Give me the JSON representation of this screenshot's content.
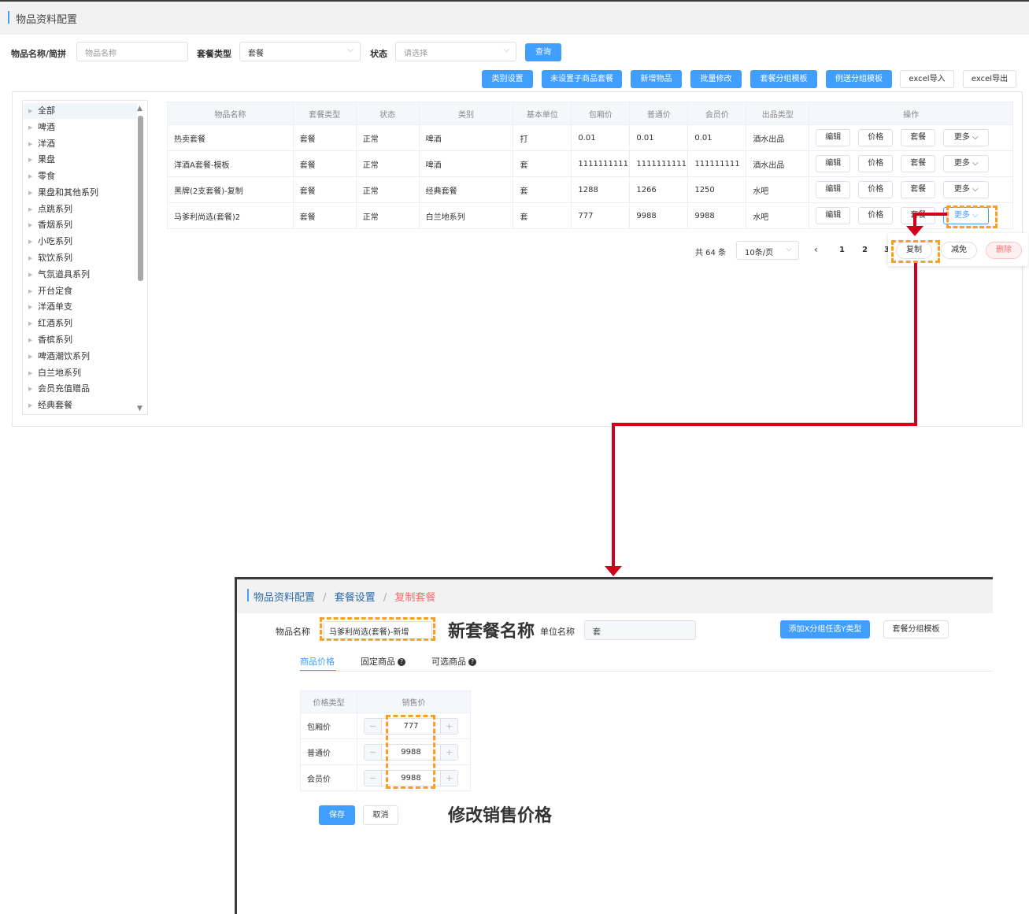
{
  "top": {
    "title": "物品资料配置",
    "filters": {
      "name_label": "物品名称/简拼",
      "name_placeholder": "物品名称",
      "type_label": "套餐类型",
      "type_value": "套餐",
      "status_label": "状态",
      "status_placeholder": "请选择",
      "query_button": "查询"
    },
    "toolbar": [
      "类别设置",
      "未设置子商品套餐",
      "新增物品",
      "批量修改",
      "套餐分组模板",
      "例送分组模板"
    ],
    "toolbar_white": [
      "excel导入",
      "excel导出"
    ],
    "tree": [
      "全部",
      "啤酒",
      "洋酒",
      "果盘",
      "零食",
      "果盘和其他系列",
      "点跳系列",
      "香烟系列",
      "小吃系列",
      "软饮系列",
      "气氛道具系列",
      "开台定食",
      "洋酒单支",
      "红酒系列",
      "香槟系列",
      "啤酒潮饮系列",
      "白兰地系列",
      "会员充值赠品",
      "经典套餐"
    ],
    "columns": [
      "物品名称",
      "套餐类型",
      "状态",
      "类别",
      "基本单位",
      "包厢价",
      "普通价",
      "会员价",
      "出品类型",
      "操作"
    ],
    "rows": [
      [
        "热卖套餐",
        "套餐",
        "正常",
        "啤酒",
        "打",
        "0.01",
        "0.01",
        "0.01",
        "酒水出品"
      ],
      [
        "洋酒A套餐-模板",
        "套餐",
        "正常",
        "啤酒",
        "套",
        "1111111111",
        "1111111111",
        "111111111",
        "酒水出品"
      ],
      [
        "黑牌(2支套餐)-复制",
        "套餐",
        "正常",
        "经典套餐",
        "套",
        "1288",
        "1266",
        "1250",
        "水吧"
      ],
      [
        "马爹利尚选(套餐)2",
        "套餐",
        "正常",
        "白兰地系列",
        "套",
        "777",
        "9988",
        "9988",
        "水吧"
      ]
    ],
    "ops": [
      "编辑",
      "价格",
      "套餐",
      "更多"
    ],
    "pager": {
      "total": "共 64 条",
      "size": "10条/页",
      "pages": [
        "1",
        "2",
        "3"
      ]
    },
    "popover": [
      "复制",
      "减免",
      "删除"
    ]
  },
  "bottom": {
    "crumbs": [
      "物品资料配置",
      "套餐设置",
      "复制套餐"
    ],
    "name_label": "物品名称",
    "name_value": "马爹利尚选(套餐)-新增",
    "note_name": "新套餐名称",
    "unit_label": "单位名称",
    "unit_value": "套",
    "btn_add": "添加X分组任选Y类型",
    "btn_template": "套餐分组模板",
    "tabs": [
      "商品价格",
      "固定商品",
      "可选商品"
    ],
    "price_head": [
      "价格类型",
      "销售价"
    ],
    "prices": [
      {
        "type": "包厢价",
        "value": "777"
      },
      {
        "type": "普通价",
        "value": "9988"
      },
      {
        "type": "会员价",
        "value": "9988"
      }
    ],
    "save": "保存",
    "cancel": "取消",
    "note_price": "修改销售价格"
  },
  "colors": {
    "accent": "#409eff",
    "highlight": "#f7a025",
    "arrow": "#d0021b",
    "danger": "#f56c6c"
  }
}
